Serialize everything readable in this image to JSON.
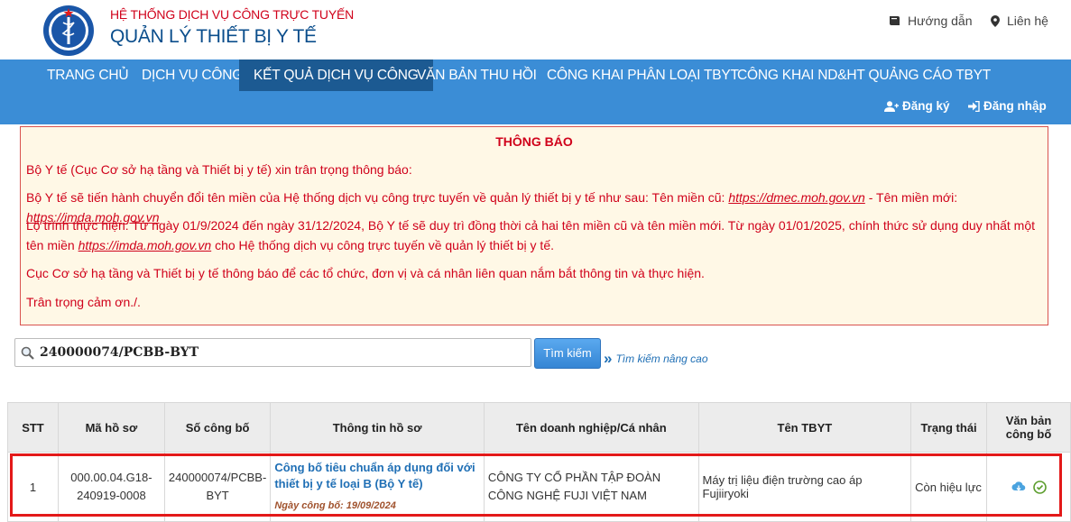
{
  "header": {
    "subtitle": "HỆ THỐNG DỊCH VỤ CÔNG TRỰC TUYẾN",
    "title": "QUẢN LÝ THIẾT BỊ Y TẾ",
    "guide": "Hướng dẫn",
    "contact": "Liên hệ"
  },
  "nav": {
    "items": [
      "TRANG CHỦ",
      "DỊCH VỤ CÔNG",
      "KẾT QUẢ DỊCH VỤ CÔNG",
      "VĂN BẢN THU HỒI",
      "CÔNG KHAI PHÂN LOẠI TBYT",
      "CÔNG KHAI ND&HT QUẢNG CÁO TBYT"
    ],
    "active_index": 2,
    "register": "Đăng ký",
    "login": "Đăng nhập"
  },
  "notice": {
    "title": "THÔNG BÁO",
    "line1": "Bộ Y tế (Cục Cơ sở hạ tầng và Thiết bị y tế) xin trân trọng thông báo:",
    "line2_a": "Bộ Y tế sẽ tiến hành chuyển đổi tên miền của Hệ thống dịch vụ công trực tuyến về quản lý thiết bị y tế như sau: Tên miền cũ: ",
    "old_domain": "https://dmec.moh.gov.vn",
    "line2_b": " - Tên miền mới: ",
    "new_domain": "https://imda.moh.gov.vn",
    "line3_a": "Lộ trình thực hiện: Từ ngày 01/9/2024 đến ngày 31/12/2024, Bộ Y tế sẽ duy trì đồng thời cả hai tên miền cũ và tên miền mới. Từ ngày 01/01/2025, chính thức sử dụng duy nhất một tên miền",
    "line3_link": "https://imda.moh.gov.vn",
    "line3_b": " cho Hệ thống dịch vụ công trực tuyến về quản lý thiết bị y tế.",
    "line4": "Cục Cơ sở hạ tầng và Thiết bị y tế thông báo để các tổ chức, đơn vị và cá nhân liên quan nắm bắt thông tin và thực hiện.",
    "line5": "Trân trọng cảm ơn./."
  },
  "search": {
    "value": "240000074/PCBB-BYT",
    "button": "Tìm kiếm",
    "advanced": "Tìm kiếm nâng cao"
  },
  "table": {
    "headers": [
      "STT",
      "Mã hồ sơ",
      "Số công bố",
      "Thông tin hồ sơ",
      "Tên doanh nghiệp/Cá nhân",
      "Tên TBYT",
      "Trạng thái",
      "Văn bản công bố"
    ],
    "row": {
      "stt": "1",
      "ma_ho_so": "000.00.04.G18-240919-0008",
      "so_cong_bo": "240000074/PCBB-BYT",
      "info_title": "Công bố tiêu chuẩn áp dụng đối với thiết bị y tế loại B (Bộ Y tế)",
      "info_date": "Ngày công bố: 19/09/2024",
      "company": "CÔNG TY CỔ PHẦN TẬP ĐOÀN CÔNG NGHỆ FUJI VIỆT NAM",
      "device": "Máy trị liệu điện trường cao áp Fujiiryoki",
      "status": "Còn hiệu lực"
    }
  },
  "colors": {
    "nav_bg": "#3b8dd6",
    "nav_active": "#1c5a92",
    "notice_text": "#d0021b",
    "highlight": "#e31919"
  }
}
